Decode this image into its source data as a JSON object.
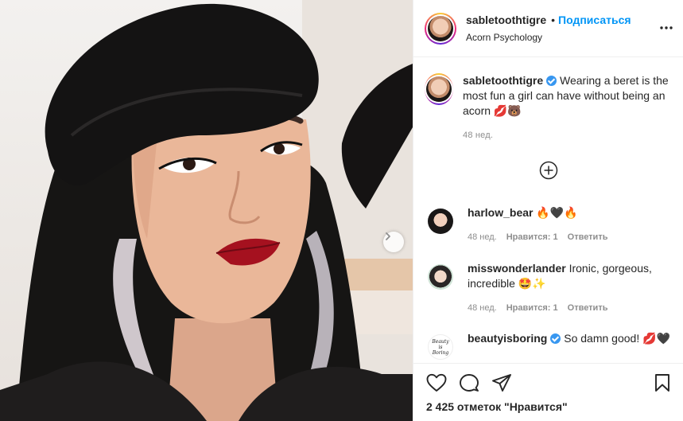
{
  "post": {
    "username": "sabletoothtigre",
    "separator": "•",
    "follow_label": "Подписаться",
    "location": "Acorn Psychology"
  },
  "caption": {
    "username": "sabletoothtigre",
    "text": "Wearing a beret is the most fun a girl can have without being an acorn 💋🐻",
    "time": "48 нед."
  },
  "comments": [
    {
      "username": "harlow_bear",
      "text": "🔥🖤🔥",
      "time": "48 нед.",
      "likes": "Нравится: 1",
      "reply": "Ответить"
    },
    {
      "username": "misswonderlander",
      "text": "Ironic, gorgeous, incredible 🤩✨",
      "time": "48 нед.",
      "likes": "Нравится: 1",
      "reply": "Ответить"
    },
    {
      "username": "beautyisboring",
      "text": "So damn good! 💋🖤",
      "avatar_text": "Beauty is Boring"
    }
  ],
  "likes_text": "2 425 отметок \"Нравится\"",
  "icons": [
    "like-heart-icon",
    "comment-icon",
    "share-plane-icon",
    "bookmark-icon",
    "more-options-icon",
    "load-more-plus-icon",
    "chevron-right-icon",
    "verified-badge-icon"
  ],
  "colors": {
    "accent": "#0095f6",
    "muted": "#8e8e8e",
    "text": "#262626",
    "verified": "#3897f0"
  }
}
